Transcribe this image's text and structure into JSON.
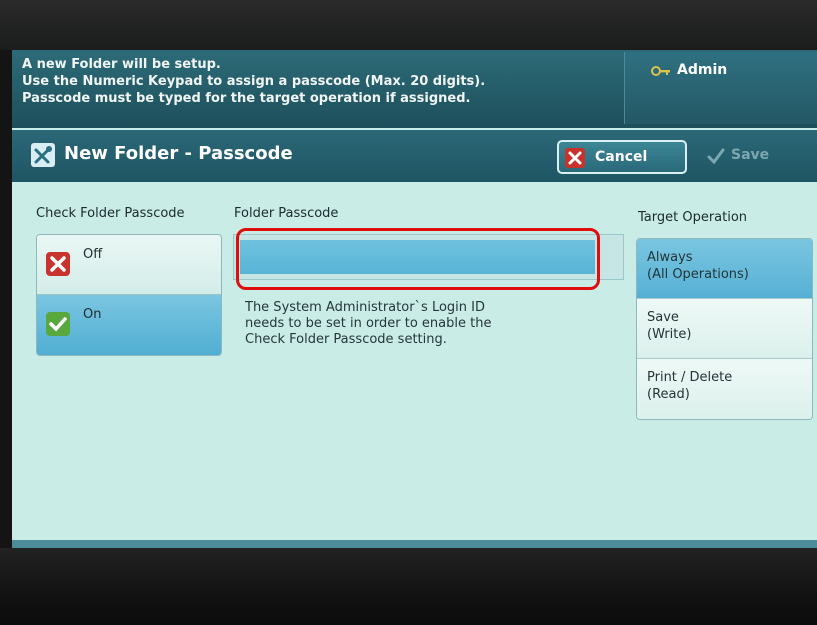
{
  "message": {
    "lines": [
      "A new Folder will be setup.",
      "Use the Numeric Keypad to assign a passcode (Max. 20 digits).",
      "Passcode must be typed for the target operation if assigned."
    ]
  },
  "user": {
    "label": "Admin",
    "icon": "admin-key-icon"
  },
  "title": {
    "text": "New Folder - Passcode",
    "icon": "tools-icon"
  },
  "toolbar": {
    "cancel_label": "Cancel",
    "save_label": "Save"
  },
  "check_folder_passcode": {
    "header": "Check Folder Passcode",
    "options": [
      {
        "label": "Off",
        "icon": "x-icon"
      },
      {
        "label": "On",
        "icon": "check-icon"
      }
    ],
    "selected": "On"
  },
  "folder_passcode": {
    "header": "Folder Passcode",
    "value": "",
    "info_lines": [
      "The System Administrator`s Login ID",
      "needs to be set in order to enable the",
      "Check Folder Passcode setting."
    ]
  },
  "target_operation": {
    "header": "Target Operation",
    "options": [
      {
        "line1": "Always",
        "line2": "(All Operations)"
      },
      {
        "line1": "Save",
        "line2": "(Write)"
      },
      {
        "line1": "Print / Delete",
        "line2": "(Read)"
      }
    ],
    "selected": "Always"
  },
  "colors": {
    "highlight": "#e00d0d",
    "selected": "#5ab4d8",
    "bar": "#225b69"
  }
}
